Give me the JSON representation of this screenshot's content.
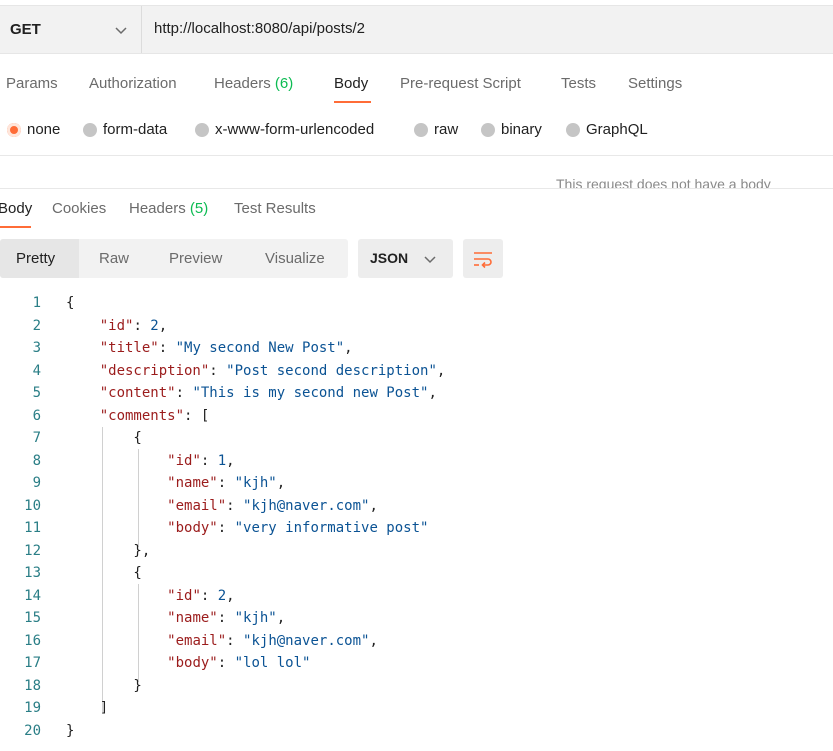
{
  "request": {
    "method": "GET",
    "url": "http://localhost:8080/api/posts/2"
  },
  "request_tabs": [
    {
      "label": "Params"
    },
    {
      "label": "Authorization"
    },
    {
      "label": "Headers",
      "count": "(6)"
    },
    {
      "label": "Body",
      "active": true
    },
    {
      "label": "Pre-request Script"
    },
    {
      "label": "Tests"
    },
    {
      "label": "Settings"
    }
  ],
  "body_types": [
    {
      "label": "none",
      "selected": true
    },
    {
      "label": "form-data"
    },
    {
      "label": "x-www-form-urlencoded"
    },
    {
      "label": "raw"
    },
    {
      "label": "binary"
    },
    {
      "label": "GraphQL"
    }
  ],
  "body_note": "This request does not have a body",
  "response_tabs": [
    {
      "label": "Body",
      "active": true
    },
    {
      "label": "Cookies"
    },
    {
      "label": "Headers",
      "count": "(5)"
    },
    {
      "label": "Test Results"
    }
  ],
  "format_buttons": [
    {
      "label": "Pretty",
      "active": true
    },
    {
      "label": "Raw"
    },
    {
      "label": "Preview"
    },
    {
      "label": "Visualize"
    }
  ],
  "language_select": "JSON",
  "icons": {
    "method_dropdown": "chevron-down-icon",
    "language_dropdown": "chevron-down-icon",
    "wrap": "wrap-lines-icon"
  },
  "colors": {
    "accent": "#ff6c37",
    "count_green": "#0cbb52",
    "json_key": "#9b1c1c",
    "json_value": "#0b5394",
    "line_number": "#2a7e86"
  },
  "code_lines": [
    {
      "n": "1",
      "parts": [
        [
          "p",
          "{"
        ]
      ]
    },
    {
      "n": "2",
      "parts": [
        [
          "p",
          "    "
        ],
        [
          "k",
          "\"id\""
        ],
        [
          "p",
          ": "
        ],
        [
          "n",
          "2"
        ],
        [
          "p",
          ","
        ]
      ]
    },
    {
      "n": "3",
      "parts": [
        [
          "p",
          "    "
        ],
        [
          "k",
          "\"title\""
        ],
        [
          "p",
          ": "
        ],
        [
          "s",
          "\"My second New Post\""
        ],
        [
          "p",
          ","
        ]
      ]
    },
    {
      "n": "4",
      "parts": [
        [
          "p",
          "    "
        ],
        [
          "k",
          "\"description\""
        ],
        [
          "p",
          ": "
        ],
        [
          "s",
          "\"Post second description\""
        ],
        [
          "p",
          ","
        ]
      ]
    },
    {
      "n": "5",
      "parts": [
        [
          "p",
          "    "
        ],
        [
          "k",
          "\"content\""
        ],
        [
          "p",
          ": "
        ],
        [
          "s",
          "\"This is my second new Post\""
        ],
        [
          "p",
          ","
        ]
      ]
    },
    {
      "n": "6",
      "parts": [
        [
          "p",
          "    "
        ],
        [
          "k",
          "\"comments\""
        ],
        [
          "p",
          ": ["
        ]
      ]
    },
    {
      "n": "7",
      "parts": [
        [
          "p",
          "        {"
        ]
      ]
    },
    {
      "n": "8",
      "parts": [
        [
          "p",
          "            "
        ],
        [
          "k",
          "\"id\""
        ],
        [
          "p",
          ": "
        ],
        [
          "n",
          "1"
        ],
        [
          "p",
          ","
        ]
      ]
    },
    {
      "n": "9",
      "parts": [
        [
          "p",
          "            "
        ],
        [
          "k",
          "\"name\""
        ],
        [
          "p",
          ": "
        ],
        [
          "s",
          "\"kjh\""
        ],
        [
          "p",
          ","
        ]
      ]
    },
    {
      "n": "10",
      "parts": [
        [
          "p",
          "            "
        ],
        [
          "k",
          "\"email\""
        ],
        [
          "p",
          ": "
        ],
        [
          "s",
          "\"kjh@naver.com\""
        ],
        [
          "p",
          ","
        ]
      ]
    },
    {
      "n": "11",
      "parts": [
        [
          "p",
          "            "
        ],
        [
          "k",
          "\"body\""
        ],
        [
          "p",
          ": "
        ],
        [
          "s",
          "\"very informative post\""
        ]
      ]
    },
    {
      "n": "12",
      "parts": [
        [
          "p",
          "        },"
        ]
      ]
    },
    {
      "n": "13",
      "parts": [
        [
          "p",
          "        {"
        ]
      ]
    },
    {
      "n": "14",
      "parts": [
        [
          "p",
          "            "
        ],
        [
          "k",
          "\"id\""
        ],
        [
          "p",
          ": "
        ],
        [
          "n",
          "2"
        ],
        [
          "p",
          ","
        ]
      ]
    },
    {
      "n": "15",
      "parts": [
        [
          "p",
          "            "
        ],
        [
          "k",
          "\"name\""
        ],
        [
          "p",
          ": "
        ],
        [
          "s",
          "\"kjh\""
        ],
        [
          "p",
          ","
        ]
      ]
    },
    {
      "n": "16",
      "parts": [
        [
          "p",
          "            "
        ],
        [
          "k",
          "\"email\""
        ],
        [
          "p",
          ": "
        ],
        [
          "s",
          "\"kjh@naver.com\""
        ],
        [
          "p",
          ","
        ]
      ]
    },
    {
      "n": "17",
      "parts": [
        [
          "p",
          "            "
        ],
        [
          "k",
          "\"body\""
        ],
        [
          "p",
          ": "
        ],
        [
          "s",
          "\"lol lol\""
        ]
      ]
    },
    {
      "n": "18",
      "parts": [
        [
          "p",
          "        }"
        ]
      ]
    },
    {
      "n": "19",
      "parts": [
        [
          "p",
          "    ]"
        ]
      ]
    },
    {
      "n": "20",
      "parts": [
        [
          "p",
          "}"
        ]
      ]
    }
  ]
}
